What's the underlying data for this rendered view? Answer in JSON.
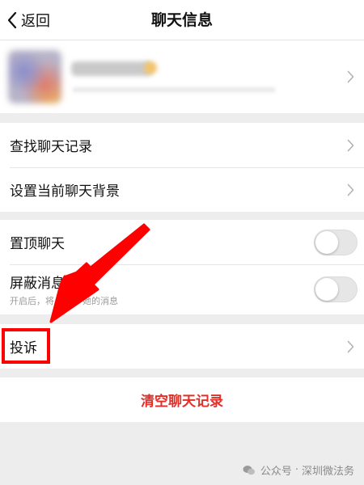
{
  "nav": {
    "back_label": "返回",
    "title": "聊天信息"
  },
  "settings_group_1": [
    {
      "label": "查找聊天记录"
    },
    {
      "label": "设置当前聊天背景"
    }
  ],
  "settings_group_2": {
    "pin": {
      "label": "置顶聊天",
      "enabled": false
    },
    "mute": {
      "label": "屏蔽消息",
      "hint": "开启后，将          她的消息",
      "enabled": false
    }
  },
  "complain": {
    "label": "投诉"
  },
  "clear": {
    "label": "清空聊天记录",
    "color": "#e0302a"
  },
  "annotation": {
    "arrow_color": "#ff0000",
    "box_color": "#ff0000"
  },
  "watermark": {
    "account_type": "公众号",
    "separator": "·",
    "account_name": "深圳微法务",
    "icon": "wechat-icon"
  }
}
